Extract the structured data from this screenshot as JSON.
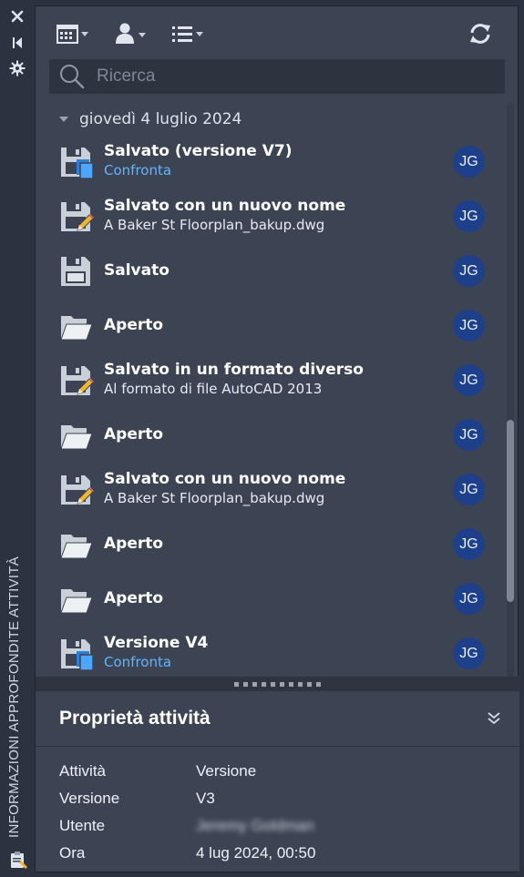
{
  "side": {
    "title": "INFORMAZIONI APPROFONDITE ATTIVITÀ",
    "icons": [
      "close-icon",
      "pin-icon",
      "settings-icon",
      "clipboard-icon"
    ]
  },
  "toolbar": {
    "icons": [
      "calendar-filter-icon",
      "user-filter-icon",
      "list-filter-icon",
      "refresh-icon"
    ]
  },
  "search": {
    "placeholder": "Ricerca",
    "value": ""
  },
  "list": {
    "date_header": "giovedì 4 luglio 2024",
    "items": [
      {
        "icon": "save-version-icon",
        "title": "Salvato (versione V7)",
        "subtitle": "Confronta",
        "subtitle_is_link": true,
        "user": "JG"
      },
      {
        "icon": "save-as-icon",
        "title": "Salvato con un nuovo nome",
        "subtitle": "A Baker St Floorplan_bakup.dwg",
        "subtitle_is_link": false,
        "user": "JG"
      },
      {
        "icon": "save-icon",
        "title": "Salvato",
        "subtitle": "",
        "subtitle_is_link": false,
        "user": "JG"
      },
      {
        "icon": "folder-open-icon",
        "title": "Aperto",
        "subtitle": "",
        "subtitle_is_link": false,
        "user": "JG"
      },
      {
        "icon": "save-as-icon",
        "title": "Salvato in un formato diverso",
        "subtitle": "Al formato di file AutoCAD 2013",
        "subtitle_is_link": false,
        "user": "JG"
      },
      {
        "icon": "folder-open-icon",
        "title": "Aperto",
        "subtitle": "",
        "subtitle_is_link": false,
        "user": "JG"
      },
      {
        "icon": "save-as-icon",
        "title": "Salvato con un nuovo nome",
        "subtitle": "A Baker St Floorplan_bakup.dwg",
        "subtitle_is_link": false,
        "user": "JG"
      },
      {
        "icon": "folder-open-icon",
        "title": "Aperto",
        "subtitle": "",
        "subtitle_is_link": false,
        "user": "JG"
      },
      {
        "icon": "folder-open-icon",
        "title": "Aperto",
        "subtitle": "",
        "subtitle_is_link": false,
        "user": "JG"
      },
      {
        "icon": "save-version-icon",
        "title": "Versione V4",
        "subtitle": "Confronta",
        "subtitle_is_link": true,
        "user": "JG"
      }
    ]
  },
  "properties": {
    "title": "Proprietà attività",
    "rows": [
      {
        "key": "Attività",
        "value": "Versione",
        "blurred": false
      },
      {
        "key": "Versione",
        "value": "V3",
        "blurred": false
      },
      {
        "key": "Utente",
        "value": "Jeremy Goldman",
        "blurred": true
      },
      {
        "key": "Ora",
        "value": "4 lug 2024, 00:50",
        "blurred": false
      }
    ]
  },
  "colors": {
    "panel": "#3c4453",
    "strip": "#2b3340",
    "link": "#61b4ff",
    "avatar": "#1e3f8a"
  }
}
